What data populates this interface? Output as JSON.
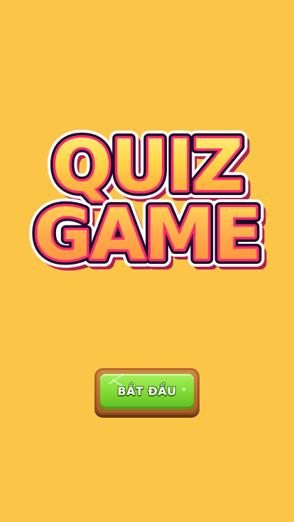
{
  "logo": {
    "line1": "QUIZ",
    "line2": "GAME"
  },
  "start_button": {
    "label": "BẮT ĐẦU"
  },
  "colors": {
    "background": "#fbc547",
    "logo_fill_top": "#fff27a",
    "logo_fill_bottom": "#ff9e3a",
    "logo_outline_inner": "#ff2a6e",
    "logo_outline_outer": "#1a0a2a",
    "button_face": "#7fd934",
    "button_frame": "#a65e26"
  }
}
